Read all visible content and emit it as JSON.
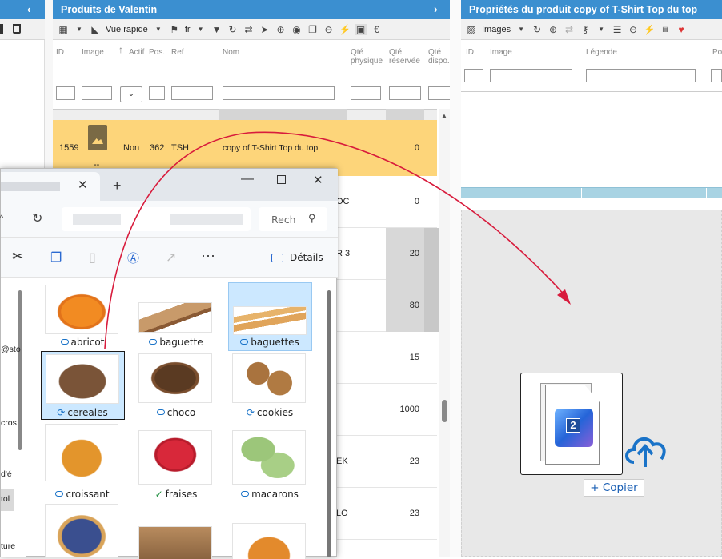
{
  "left_panel": {
    "collapse_icon": "chevron-left-icon",
    "trash_icon": "trash-icon"
  },
  "products_panel": {
    "title": "Produits de Valentin",
    "toolbar": {
      "quick_view": "Vue rapide",
      "lang": "fr"
    },
    "columns": [
      "ID",
      "Image",
      "Actif",
      "Pos.",
      "Ref",
      "Nom",
      "Qté physique",
      "Qté réservée",
      "Qté dispo."
    ],
    "col_physique": [
      "Qté",
      "physique"
    ],
    "col_reservee": [
      "Qté",
      "réservée"
    ],
    "col_dispo": [
      "Qté",
      "dispo."
    ],
    "selected_row": {
      "id": "1559",
      "actif": "Non",
      "pos": "362",
      "ref": "TSH",
      "nom": "copy of T-Shirt Top du top",
      "qte_reservee": "0",
      "image_caption": "--"
    },
    "rows": [
      {
        "nom_fragment": "OC",
        "qte_reservee": "0"
      },
      {
        "nom_fragment": "R 3",
        "qte_reservee": "20"
      },
      {
        "nom_fragment": "",
        "qte_reservee": "80"
      },
      {
        "nom_fragment": "",
        "qte_reservee": "15"
      },
      {
        "nom_fragment": "",
        "qte_reservee": "1000"
      },
      {
        "nom_fragment": "EK",
        "qte_reservee": "23"
      },
      {
        "nom_fragment": "LO",
        "qte_reservee": "23"
      }
    ]
  },
  "properties_panel": {
    "title": "Propriétés du produit copy of T-Shirt Top du top",
    "toolbar": {
      "images": "Images"
    },
    "columns": [
      "ID",
      "Image",
      "Légende",
      "Po"
    ]
  },
  "drag": {
    "badge": "2",
    "copy_label": "+ Copier"
  },
  "explorer": {
    "search_placeholder": "Rech",
    "details_label": "Détails",
    "side_fragments": [
      "@sto",
      "cros",
      "d'é",
      "tol",
      "ture"
    ],
    "files": [
      {
        "name": "abricot",
        "status": "cloud"
      },
      {
        "name": "baguette",
        "status": "cloud"
      },
      {
        "name": "baguettes",
        "status": "cloud"
      },
      {
        "name": "cereales",
        "status": "sync"
      },
      {
        "name": "choco",
        "status": "cloud"
      },
      {
        "name": "cookies",
        "status": "sync"
      },
      {
        "name": "croissant",
        "status": "cloud"
      },
      {
        "name": "fraises",
        "status": "available"
      },
      {
        "name": "macarons",
        "status": "cloud"
      },
      {
        "name": "",
        "status": ""
      },
      {
        "name": "",
        "status": ""
      },
      {
        "name": "",
        "status": ""
      }
    ]
  },
  "colors": {
    "header_blue": "#3b8fd0",
    "selected_row": "#fdd57a",
    "drag_arrow": "#d81b3c",
    "explorer_selected": "#cce8ff",
    "upload_blue": "#1a73c8"
  }
}
